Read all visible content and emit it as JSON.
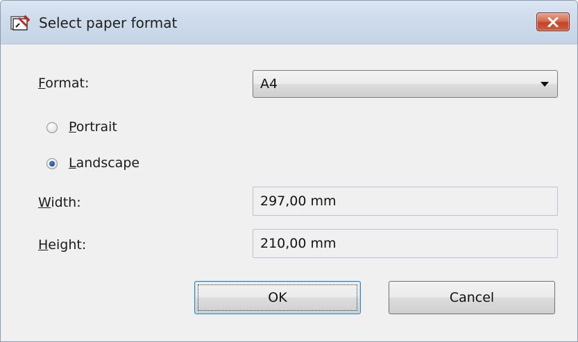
{
  "window": {
    "title": "Select paper format"
  },
  "form": {
    "format_label": "Format:",
    "format_access_key": "F",
    "format_rest": "ormat:",
    "format_value": "A4",
    "portrait_access_key": "P",
    "portrait_rest": "ortrait",
    "portrait_checked": false,
    "landscape_access_key": "L",
    "landscape_rest": "andscape",
    "landscape_checked": true,
    "width_access_key": "W",
    "width_rest": "idth:",
    "width_value": "297,00 mm",
    "height_access_key": "H",
    "height_rest": "eight:",
    "height_value": "210,00 mm"
  },
  "buttons": {
    "ok_label": "OK",
    "cancel_label": "Cancel"
  },
  "colors": {
    "titlebar": "#cfdcec",
    "close_button": "#c2452a",
    "dialog_background": "#f0f0f0",
    "radio_checked": "#1d4ea3",
    "default_button_border": "#3c7fb1"
  },
  "icons": {
    "app": "paper-format-app-icon",
    "close": "close-icon",
    "dropdown": "chevron-down-icon"
  }
}
